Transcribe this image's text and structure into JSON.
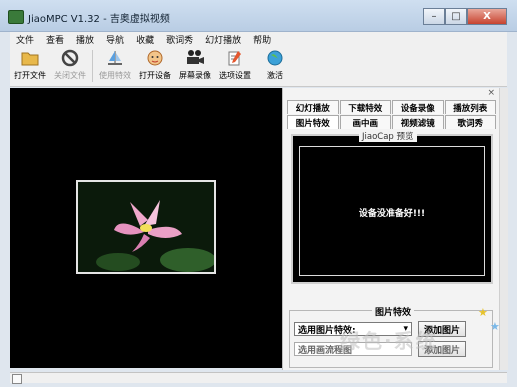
{
  "window": {
    "title": "JiaoMPC V1.32 - 吉奥虚拟视频",
    "close_glyph": "X",
    "minimize_glyph": "–",
    "maximize_glyph": "□"
  },
  "menu": [
    "文件",
    "查看",
    "播放",
    "导航",
    "收藏",
    "歌词秀",
    "幻灯播放",
    "帮助"
  ],
  "toolbar": {
    "open_file": "打开文件",
    "close_file": "关闭文件",
    "use_effect": "使用特效",
    "open_device": "打开设备",
    "screen_record": "屏幕录像",
    "options": "选项设置",
    "activate": "激活"
  },
  "panel": {
    "close_glyph": "×",
    "tabs_row1": [
      "幻灯播放",
      "下载特效",
      "设备录像",
      "播放列表"
    ],
    "tabs_row2": [
      "图片特效",
      "画中画",
      "视频滤镜",
      "歌词秀"
    ],
    "preview_title": "JiaoCap 预览",
    "preview_message": "设备没准备好!!!",
    "effects_title": "图片特效",
    "select_label": "选用图片特效:",
    "add_button": "添加图片",
    "select_label2": "选用画流程图",
    "add_button2": "添加图片"
  },
  "watermark": "绿色·系统"
}
